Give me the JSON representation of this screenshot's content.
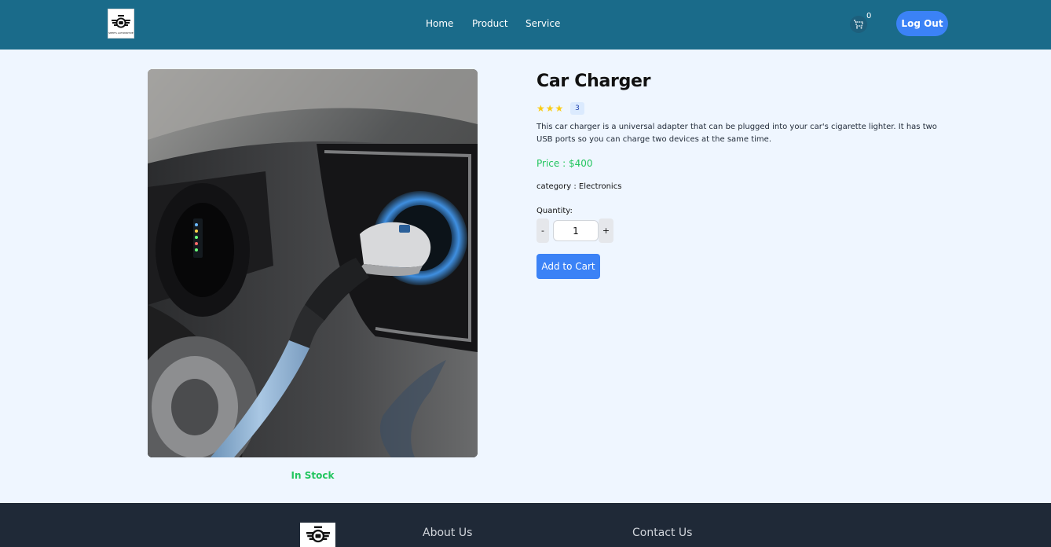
{
  "header": {
    "logo_text": "SHEE'S AUTOMOTIVE",
    "nav": {
      "home": "Home",
      "product": "Product",
      "service": "Service"
    },
    "cart_count": "0",
    "logout_label": "Log Out"
  },
  "product": {
    "title": "Car Charger",
    "rating_stars": 3,
    "rating_count": "3",
    "description": "This car charger is a universal adapter that can be plugged into your car's cigarette lighter. It has two USB ports so you can charge two devices at the same time.",
    "price": "Price : $400",
    "category": "category : Electronics",
    "quantity_label": "Quantity:",
    "quantity_value": "1",
    "minus_label": "-",
    "plus_label": "+",
    "add_to_cart_label": "Add to Cart",
    "stock": "In Stock"
  },
  "footer": {
    "about": "About Us",
    "contact": "Contact Us"
  },
  "colors": {
    "header_bg": "#1a6b8a",
    "accent_blue": "#3b82f6",
    "stock_green": "#22c55e",
    "star_yellow": "#facc15",
    "footer_bg": "#1f2937"
  },
  "icons": [
    "logo-icon",
    "cart-icon",
    "star-icon"
  ]
}
